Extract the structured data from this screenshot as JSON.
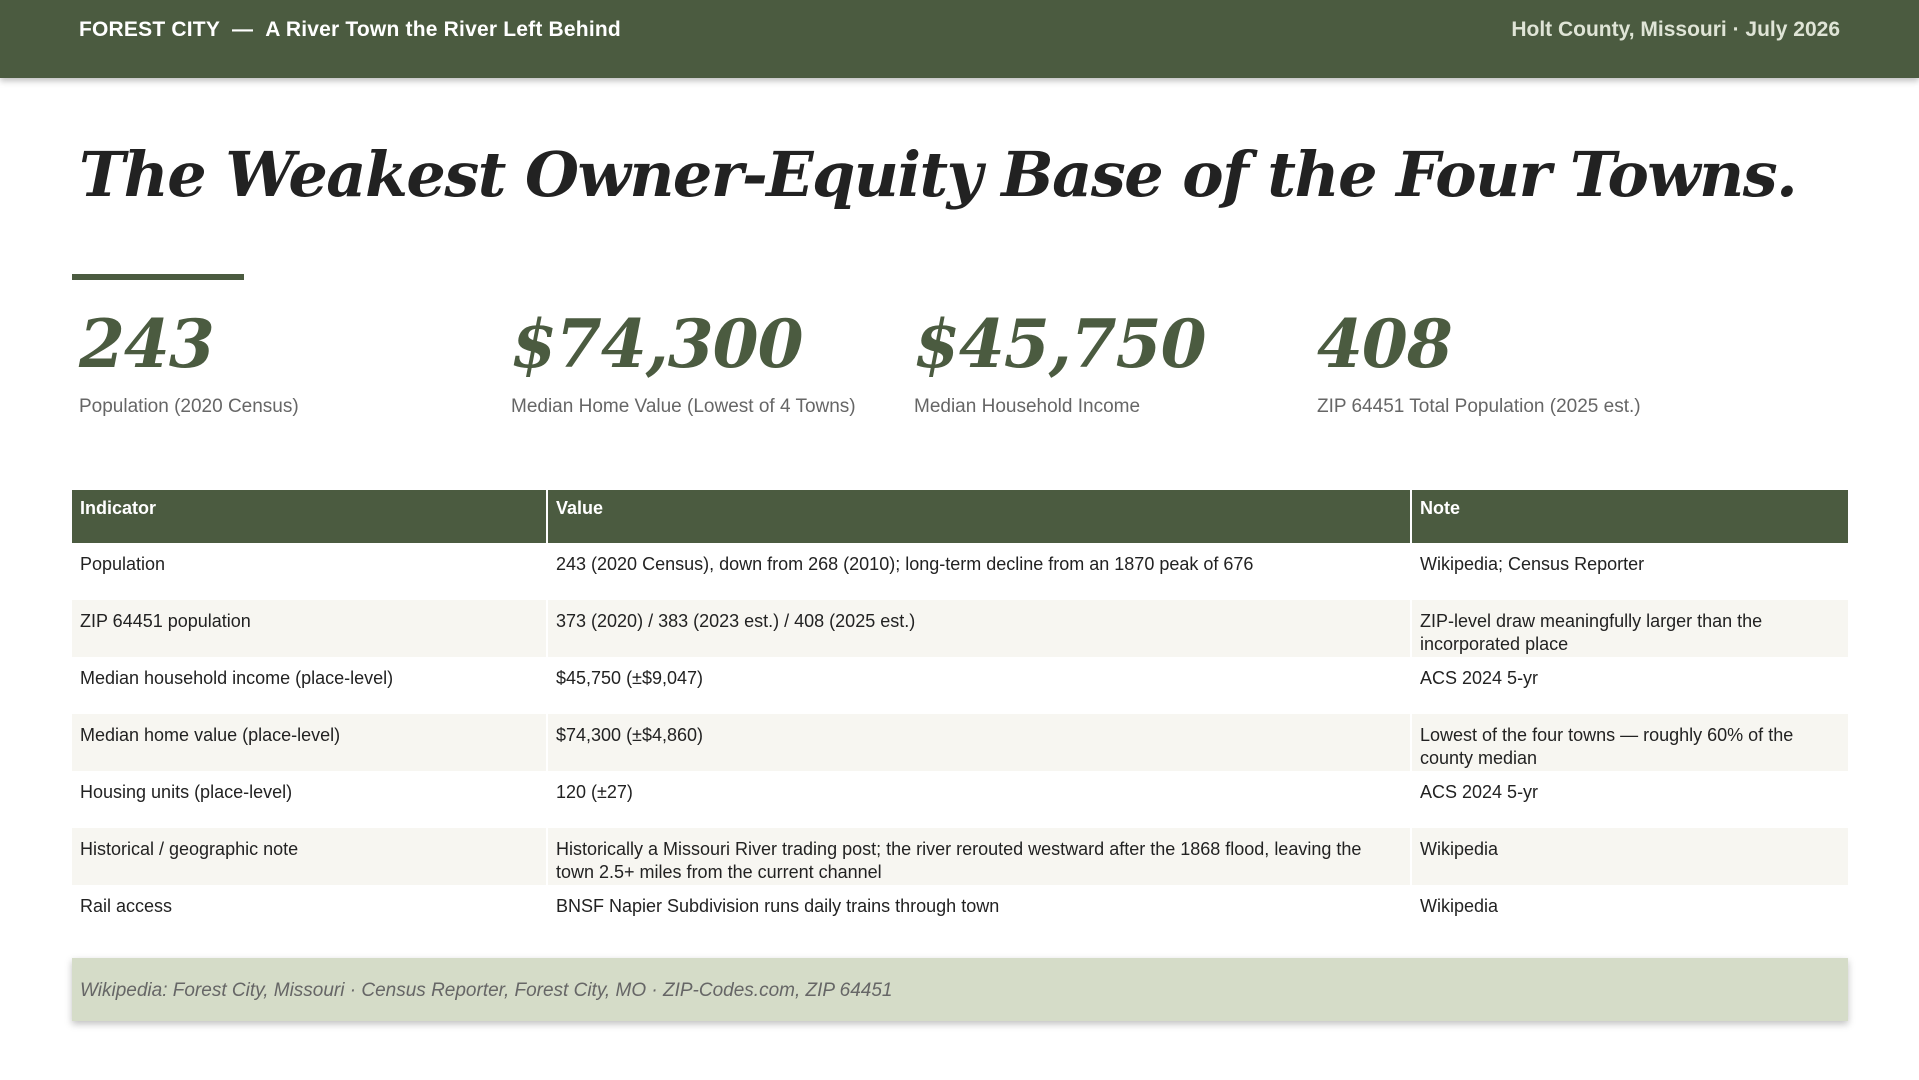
{
  "header": {
    "town": "FOREST CITY",
    "separator": "—",
    "tagline": "A River Town the River Left Behind",
    "location_date": "Holt County, Missouri · July 2026"
  },
  "headline": "The Weakest Owner-Equity Base of the Four Towns.",
  "stats": [
    {
      "value": "243",
      "label": "Population (2020 Census)"
    },
    {
      "value": "$74,300",
      "label": "Median Home Value (Lowest of 4 Towns)"
    },
    {
      "value": "$45,750",
      "label": "Median Household Income"
    },
    {
      "value": "408",
      "label": "ZIP 64451 Total Population (2025 est.)"
    }
  ],
  "table": {
    "headers": [
      "Indicator",
      "Value",
      "Note"
    ],
    "rows": [
      [
        "Population",
        "243 (2020 Census), down from 268 (2010); long-term decline from an 1870 peak of 676",
        "Wikipedia; Census Reporter"
      ],
      [
        "ZIP 64451 population",
        "373 (2020) / 383 (2023 est.) / 408 (2025 est.)",
        "ZIP-level draw meaningfully larger than the incorporated place"
      ],
      [
        "Median household income (place-level)",
        "$45,750 (±$9,047)",
        "ACS 2024 5-yr"
      ],
      [
        "Median home value (place-level)",
        "$74,300 (±$4,860)",
        "Lowest of the four towns — roughly 60% of the county median"
      ],
      [
        "Housing units (place-level)",
        "120 (±27)",
        "ACS 2024 5-yr"
      ],
      [
        "Historical / geographic note",
        "Historically a Missouri River trading post; the river rerouted westward after the 1868 flood, leaving the town 2.5+ miles from the current channel",
        "Wikipedia"
      ],
      [
        "Rail access",
        "BNSF Napier Subdivision runs daily trains through town",
        "Wikipedia"
      ]
    ]
  },
  "sources": "Wikipedia: Forest City, Missouri · Census Reporter, Forest City, MO · ZIP-Codes.com, ZIP 64451",
  "colors": {
    "accent": "#4b5b40",
    "sources_bg": "#d5dcc8",
    "stripe": "#f7f6f1"
  }
}
